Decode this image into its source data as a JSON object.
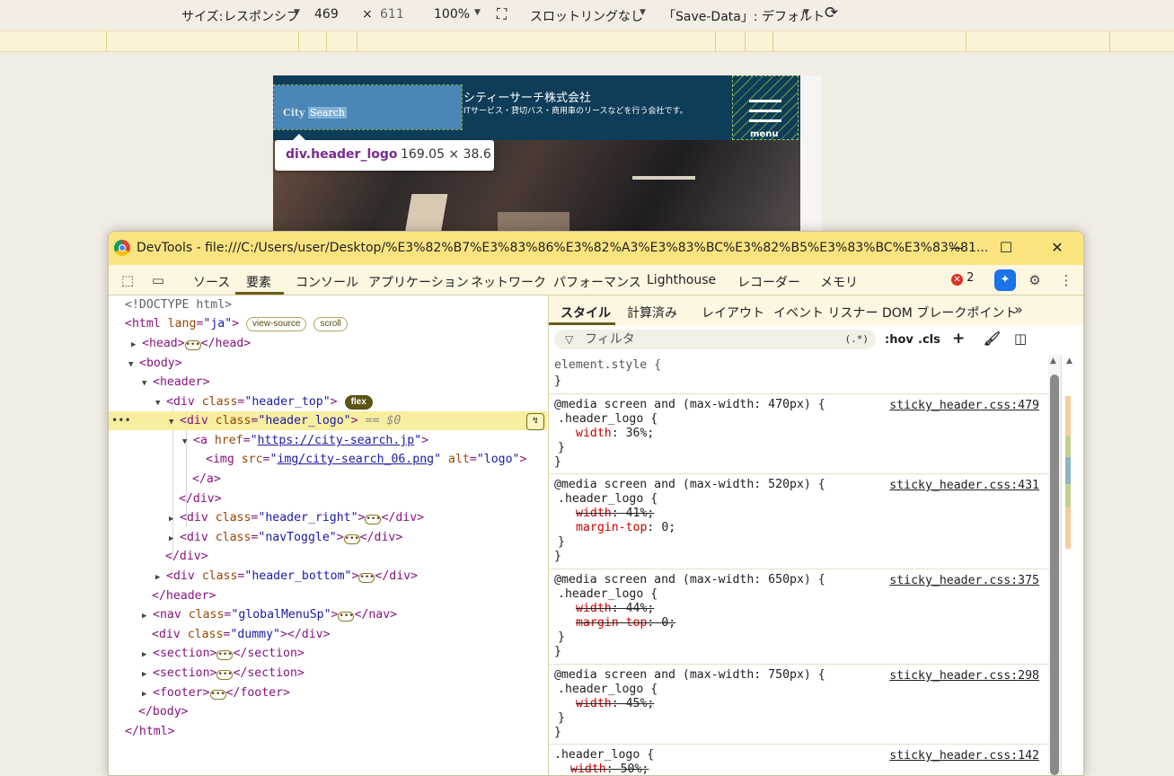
{
  "device_toolbar": {
    "size_label": "サイズ:",
    "size_value": "レスポンシブ",
    "width": "469",
    "times": "×",
    "height": "611",
    "zoom": "100%",
    "throttle": "スロットリングなし",
    "save_data": "「Save-Data」: デフォルト"
  },
  "page": {
    "logo_text_1": "City",
    "logo_text_2": "Search",
    "company": "シティーサーチ株式会社",
    "tagline": "ITサービス・貸切バス・商用車のリースなどを行う会社です。",
    "menu": "menu"
  },
  "tooltip": {
    "name": "div.header_logo",
    "size": "169.05 × 38.6"
  },
  "window": {
    "title": "DevTools - file:///C:/Users/user/Desktop/%E3%82%B7%E3%83%86%E3%82%A3%E3%83%BC%E3%82%B5%E3%83%BC%E3%83%81..."
  },
  "tabs": [
    {
      "label": "ソース"
    },
    {
      "label": "要素"
    },
    {
      "label": "コンソール"
    },
    {
      "label": "アプリケーション"
    },
    {
      "label": "ネットワーク"
    },
    {
      "label": "パフォーマンス"
    },
    {
      "label": "Lighthouse"
    },
    {
      "label": "レコーダー"
    },
    {
      "label": "メモリ"
    }
  ],
  "error_count": "2",
  "dom": {
    "doctype": "<!DOCTYPE html>",
    "html_open": "<html",
    "html_lang_attr": "lang",
    "html_lang_val": "\"ja\"",
    "badge_view_source": "view-source",
    "badge_scroll": "scroll",
    "badge_flex": "flex",
    "head": "<head>",
    "head_close": "</head>",
    "body": "<body>",
    "header": "<header>",
    "div_open": "<div",
    "class_attr": "class",
    "header_top_val": "\"header_top\"",
    "header_logo_val": "\"header_logo\"",
    "eq_sel": "== $0",
    "a_open": "<a",
    "href_attr": "href",
    "href_val": "https://city-search.jp",
    "img_open": "<img",
    "src_attr": "src",
    "src_val": "img/city-search_06.png",
    "alt_attr": "alt",
    "alt_val": "\"logo\"",
    "a_close": "</a>",
    "div_close": "</div>",
    "header_right_val": "\"header_right\"",
    "navtoggle_val": "\"navToggle\"",
    "header_bottom_val": "\"header_bottom\"",
    "header_close": "</header>",
    "nav_open": "<nav",
    "global_menu_val": "\"globalMenuSp\"",
    "nav_close": "</nav>",
    "dummy_val": "\"dummy\"",
    "section": "<section>",
    "section_close": "</section>",
    "footer": "<footer>",
    "footer_close": "</footer>",
    "body_close": "</body>",
    "html_close": "</html>",
    "gt": ">",
    "eq": "=",
    "q": "\""
  },
  "styles_tabs": [
    {
      "label": "スタイル"
    },
    {
      "label": "計算済み"
    },
    {
      "label": "レイアウト"
    },
    {
      "label": "イベント リスナー"
    },
    {
      "label": "DOM ブレークポイント"
    }
  ],
  "filter": {
    "placeholder": "フィルタ",
    "regex": "(.*)",
    "hov": ":hov",
    "cls": ".cls"
  },
  "rules": {
    "element_style": "element.style {",
    "close": "}",
    "media_470": "@media screen and (max-width: 470px) {",
    "src_479": "sticky_header.css:479",
    "media_520": "@media screen and (max-width: 520px) {",
    "src_431": "sticky_header.css:431",
    "media_650": "@media screen and (max-width: 650px) {",
    "src_375": "sticky_header.css:375",
    "media_750": "@media screen and (max-width: 750px) {",
    "src_298": "sticky_header.css:298",
    "src_142": "sticky_header.css:142",
    "selector": ".header_logo {",
    "p_width": "width",
    "p_margin_top": "margin-top",
    "v36": "36%;",
    "v41": "41%;",
    "v0": "0;",
    "v44": "44%;",
    "v45": "45%;",
    "v50": "50%;",
    "colon": ":"
  }
}
